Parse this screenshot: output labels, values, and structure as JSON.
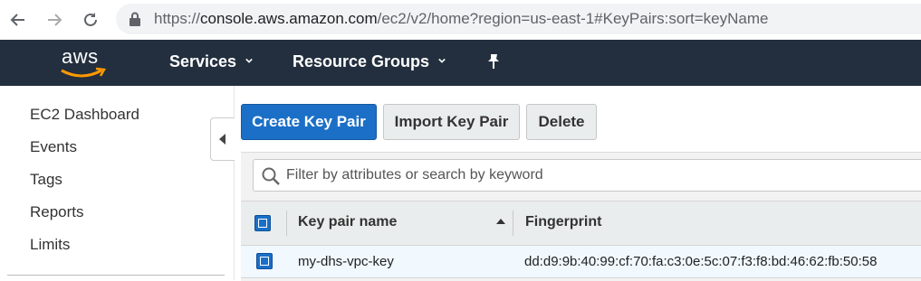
{
  "browser": {
    "url_prefix": "https://",
    "url_host": "console.aws.amazon.com",
    "url_rest": "/ec2/v2/home?region=us-east-1#KeyPairs:sort=keyName"
  },
  "header": {
    "logo_text": "aws",
    "services_label": "Services",
    "resource_groups_label": "Resource Groups",
    "bg_color": "#232f3e",
    "logo_smile_color": "#ff9900"
  },
  "sidebar": {
    "items": [
      {
        "label": "EC2 Dashboard"
      },
      {
        "label": "Events"
      },
      {
        "label": "Tags"
      },
      {
        "label": "Reports"
      },
      {
        "label": "Limits"
      }
    ]
  },
  "toolbar": {
    "create_label": "Create Key Pair",
    "import_label": "Import Key Pair",
    "delete_label": "Delete",
    "primary_color": "#1b6fc7"
  },
  "search": {
    "placeholder": "Filter by attributes or search by keyword"
  },
  "table": {
    "columns": [
      "Key pair name",
      "Fingerprint"
    ],
    "sort_column": "Key pair name",
    "sort_direction": "ascending",
    "rows": [
      {
        "selected": true,
        "name": "my-dhs-vpc-key",
        "fingerprint": "dd:d9:9b:40:99:cf:70:fa:c3:0e:5c:07:f3:f8:bd:46:62:fb:50:58"
      }
    ]
  }
}
